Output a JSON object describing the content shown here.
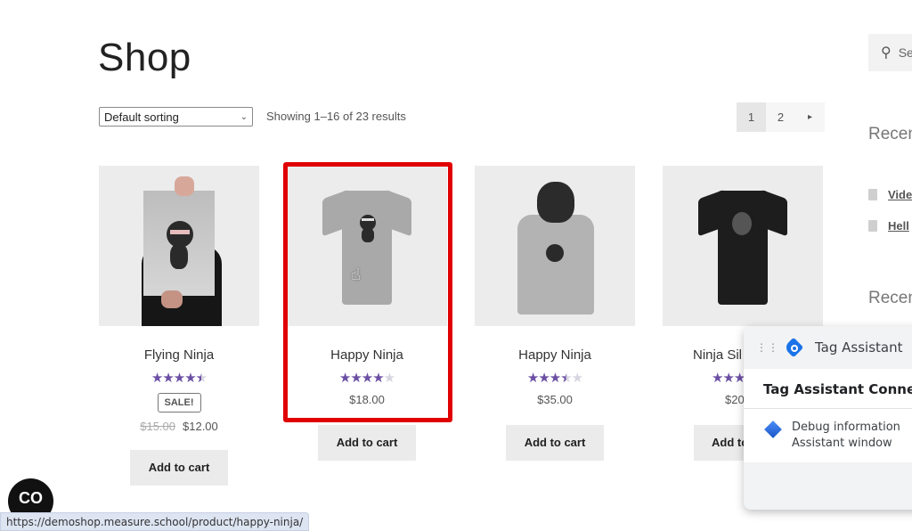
{
  "page": {
    "title": "Shop"
  },
  "toolbar": {
    "sort_selected": "Default sorting",
    "result_count": "Showing 1–16 of 23 results"
  },
  "pagination": {
    "pages": [
      "1",
      "2"
    ],
    "current": "1",
    "next_icon": "▸"
  },
  "sidebar": {
    "search_placeholder": "Se",
    "search_icon": "search-icon",
    "heading_1": "Recen",
    "links": [
      "Vide",
      "Hell"
    ],
    "heading_2": "Recen"
  },
  "products": [
    {
      "name": "Flying Ninja",
      "rating": 4.5,
      "rating_max": 5,
      "badge": "SALE!",
      "price_old": "$15.00",
      "price": "$12.00",
      "cart_label": "Add to cart"
    },
    {
      "name": "Happy Ninja",
      "rating": 4,
      "rating_max": 5,
      "price": "$18.00",
      "cart_label": "Add to cart",
      "highlighted": true
    },
    {
      "name": "Happy Ninja",
      "rating": 3.5,
      "rating_max": 5,
      "price": "$35.00",
      "cart_label": "Add to cart"
    },
    {
      "name": "Ninja Sil",
      "rating": 3.5,
      "rating_max": 5,
      "price": "$20",
      "cart_label": "Add to"
    }
  ],
  "colors": {
    "star_on": "#6b4fa3",
    "star_off": "#d7d5e0",
    "highlight": "#e00000",
    "tag_assistant_blue": "#1a73e8"
  },
  "tag_assistant": {
    "title": "Tag Assistant",
    "connected": "Tag Assistant Connec",
    "debug_line1": "Debug information",
    "debug_line2": "Assistant window "
  },
  "status_bar": {
    "url": "https://demoshop.measure.school/product/happy-ninja/"
  },
  "overlay_logo": {
    "text": "CO"
  }
}
